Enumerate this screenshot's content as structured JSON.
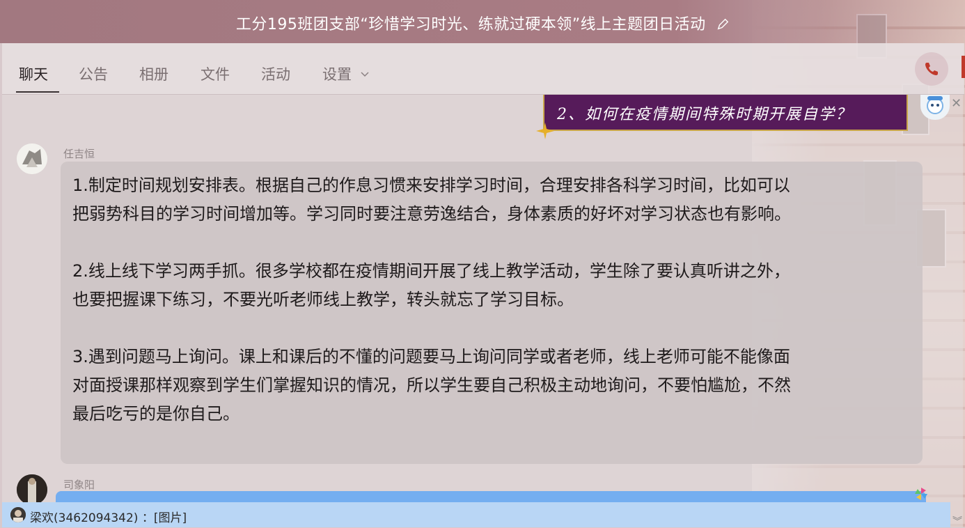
{
  "window": {
    "title": "工分195班团支部“珍惜学习时光、练就过硬本领”线上主题团日活动"
  },
  "tabs": [
    {
      "label": "聊天",
      "active": true
    },
    {
      "label": "公告",
      "active": false
    },
    {
      "label": "相册",
      "active": false
    },
    {
      "label": "文件",
      "active": false
    },
    {
      "label": "活动",
      "active": false
    },
    {
      "label": "设置",
      "active": false
    }
  ],
  "banner": {
    "text": "2、如何在疫情期间特殊时期开展自学？"
  },
  "messages": [
    {
      "sender": "任吉恒",
      "paragraphs": [
        "1.制定时间规划安排表。根据自己的作息习惯来安排学习时间，合理安排各科学习时间，比如可以",
        "把弱势科目的学习时间增加等。学习同时要注意劳逸结合，身体素质的好坏对学习状态也有影响。",
        "2.线上线下学习两手抓。很多学校都在疫情期间开展了线上教学活动，学生除了要认真听讲之外，",
        "也要把握课下练习，不要光听老师线上教学，转头就忘了学习目标。",
        "3.遇到问题马上询问。课上和课后的不懂的问题要马上询问同学或者老师，线上老师可能不能像面",
        "对面授课那样观察到学生们掌握知识的情况，所以学生要自己积极主动地询问，不要怕尴尬，不然",
        "最后吃亏的是你自己。"
      ]
    },
    {
      "sender": "司象阳"
    }
  ],
  "notification": {
    "text": "梁欢(3462094342) ：[图片]"
  },
  "colors": {
    "titlebar": "#a27880",
    "banner": "#561b5a",
    "notification": "#b9d6f5",
    "phone_icon": "#c0392b"
  },
  "icons": [
    "edit-icon",
    "chevron-down-icon",
    "phone-icon",
    "star-icon",
    "pinwheel-icon",
    "scroll-down-icon"
  ]
}
